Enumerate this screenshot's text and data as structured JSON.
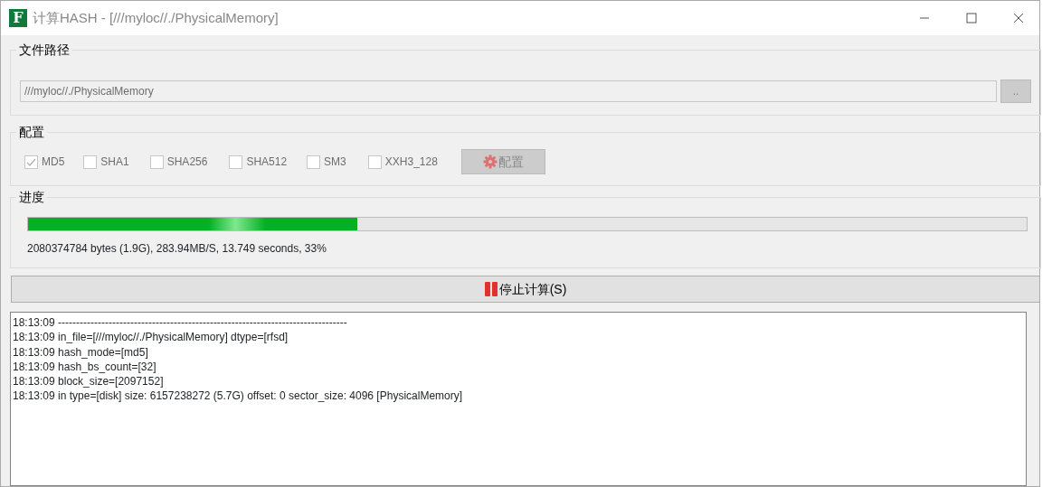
{
  "window": {
    "title": "计算HASH - [///myloc//./PhysicalMemory]",
    "logo": "F"
  },
  "path_group": {
    "title": "文件路径",
    "path_field": {
      "value": "///myloc//./PhysicalMemory",
      "disabled": true
    },
    "browse_button": {
      "label": "..",
      "disabled": true
    }
  },
  "config_group": {
    "title": "配置",
    "algorithms": [
      {
        "label": "MD5",
        "checked": true,
        "disabled": true
      },
      {
        "label": "SHA1",
        "checked": false,
        "disabled": true
      },
      {
        "label": "SHA256",
        "checked": false,
        "disabled": true
      },
      {
        "label": "SHA512",
        "checked": false,
        "disabled": true
      },
      {
        "label": "SM3",
        "checked": false,
        "disabled": true
      },
      {
        "label": "XXH3_128",
        "checked": false,
        "disabled": true
      }
    ],
    "config_button": {
      "label": "配置",
      "disabled": true
    }
  },
  "progress_group": {
    "title": "进度",
    "level": 0.33,
    "status": "2080374784 bytes (1.9G), 283.94MB/S, 13.749 seconds, 33%"
  },
  "stop_button": {
    "label": "停止计算(S)"
  },
  "log": [
    "18:13:09 --------------------------------------------------------------------------------",
    "18:13:09 in_file=[///myloc//./PhysicalMemory] dtype=[rfsd]",
    "18:13:09 hash_mode=[md5]",
    "18:13:09 hash_bs_count=[32]",
    "18:13:09 block_size=[2097152]",
    "18:13:09 in type=[disk] size: 6157238272 (5.7G) offset: 0 sector_size: 4096 [PhysicalMemory]"
  ]
}
